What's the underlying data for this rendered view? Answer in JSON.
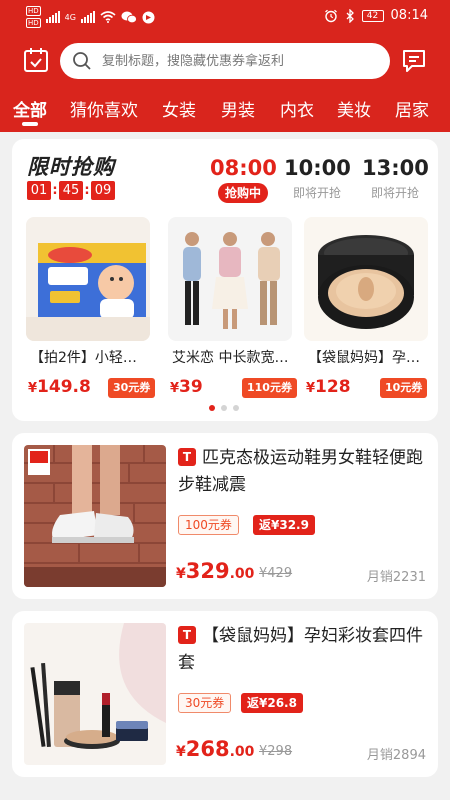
{
  "status_bar": {
    "network_label": "4G",
    "time": "08:14",
    "battery": "42"
  },
  "search": {
    "placeholder": "复制标题，搜隐藏优惠券拿返利"
  },
  "icons": {
    "left": "calendar-check-icon",
    "search": "search-icon",
    "right": "message-icon"
  },
  "tabs": [
    {
      "label": "全部",
      "active": true
    },
    {
      "label": "猜你喜欢"
    },
    {
      "label": "女装"
    },
    {
      "label": "男装"
    },
    {
      "label": "内衣"
    },
    {
      "label": "美妆"
    },
    {
      "label": "居家"
    }
  ],
  "flash_sale": {
    "title": "限时抢购",
    "countdown": [
      "01",
      "45",
      "09"
    ],
    "sessions": [
      {
        "time": "08:00",
        "status": "抢购中",
        "active": true
      },
      {
        "time": "10:00",
        "status": "即将开抢"
      },
      {
        "time": "13:00",
        "status": "即将开抢"
      }
    ],
    "items": [
      {
        "name": "【拍2件】小轻…",
        "currency": "¥",
        "price": "149.8",
        "coupon": "30元券"
      },
      {
        "name": "艾米恋 中长款宽…",
        "currency": "¥",
        "price": "39",
        "coupon": "110元券"
      },
      {
        "name": "【袋鼠妈妈】孕…",
        "currency": "¥",
        "price": "128",
        "coupon": "10元券"
      }
    ],
    "page_dots": 3,
    "active_dot": 0
  },
  "products": [
    {
      "badge": "T",
      "title": "匹克态极运动鞋男女鞋轻便跑步鞋减震",
      "coupon": "100元券",
      "rebate": "返¥32.9",
      "currency": "¥",
      "price_int": "329",
      "price_dec": ".00",
      "original_price": "¥429",
      "sales_label": "月销",
      "sales": "2231"
    },
    {
      "badge": "T",
      "title": "【袋鼠妈妈】孕妇彩妆套四件套",
      "coupon": "30元券",
      "rebate": "返¥26.8",
      "currency": "¥",
      "price_int": "268",
      "price_dec": ".00",
      "original_price": "¥298",
      "sales_label": "月销",
      "sales": "2894"
    }
  ],
  "colors": {
    "brand_red": "#d9251d",
    "price_red": "#e2231a",
    "coupon_orange": "#ef4a25"
  }
}
